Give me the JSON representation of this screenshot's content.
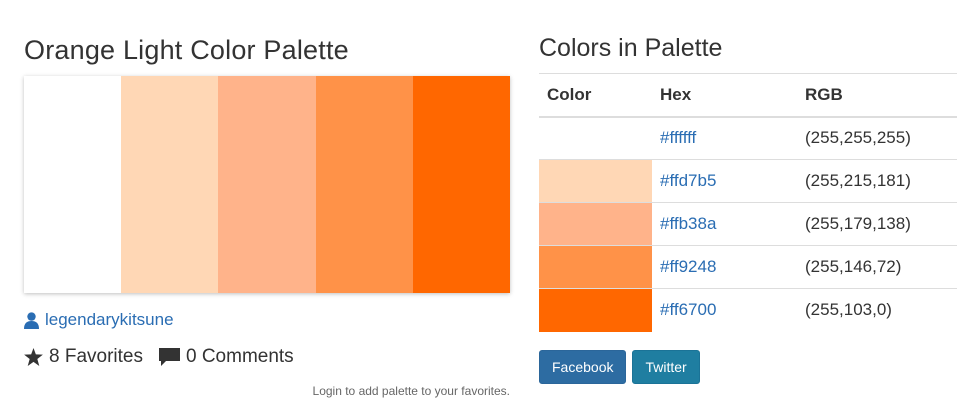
{
  "palette": {
    "title": "Orange Light Color Palette",
    "colors": [
      "#ffffff",
      "#ffd7b5",
      "#ffb38a",
      "#ff9248",
      "#ff6700"
    ],
    "author": "legendarykitsune",
    "favorites": "8 Favorites",
    "comments": "0 Comments",
    "login_note": "Login to add palette to your favorites."
  },
  "colors_panel": {
    "title": "Colors in Palette",
    "headers": {
      "color": "Color",
      "hex": "Hex",
      "rgb": "RGB"
    },
    "rows": [
      {
        "hex": "#ffffff",
        "rgb": "(255,255,255)"
      },
      {
        "hex": "#ffd7b5",
        "rgb": "(255,215,181)"
      },
      {
        "hex": "#ffb38a",
        "rgb": "(255,179,138)"
      },
      {
        "hex": "#ff9248",
        "rgb": "(255,146,72)"
      },
      {
        "hex": "#ff6700",
        "rgb": "(255,103,0)"
      }
    ]
  },
  "share": {
    "facebook": "Facebook",
    "twitter": "Twitter"
  },
  "icons": {
    "user": "user-icon",
    "star": "star-icon",
    "comment": "comment-icon"
  },
  "theme": {
    "link": "#2a6db3",
    "facebook": "#2d6ca2",
    "twitter": "#1f7ea1"
  }
}
